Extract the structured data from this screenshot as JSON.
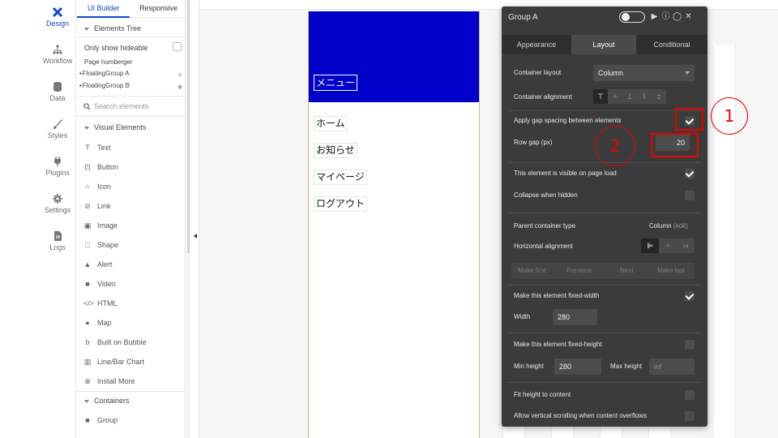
{
  "rail": {
    "items": [
      {
        "label": "Design",
        "icon": "design-icon"
      },
      {
        "label": "Workflow",
        "icon": "workflow-icon"
      },
      {
        "label": "Data",
        "icon": "data-icon"
      },
      {
        "label": "Styles",
        "icon": "brush-icon"
      },
      {
        "label": "Plugins",
        "icon": "plug-icon"
      },
      {
        "label": "Settings",
        "icon": "gear-icon"
      },
      {
        "label": "Logs",
        "icon": "document-icon"
      }
    ]
  },
  "panel": {
    "tabs": [
      "UI Builder",
      "Responsive"
    ],
    "elements_tree": "Elements Tree",
    "only_show_hideable": "Only show hideable",
    "tree_items": [
      "Page humberger",
      "FloatingGroup A",
      "FloatingGroup B"
    ],
    "search_placeholder": "Search elements",
    "visual_elements": "Visual Elements",
    "elements": [
      {
        "label": "Text",
        "icon": "T"
      },
      {
        "label": "Button",
        "icon": "⊡"
      },
      {
        "label": "Icon",
        "icon": "☆"
      },
      {
        "label": "Link",
        "icon": "⊘"
      },
      {
        "label": "Image",
        "icon": "▣"
      },
      {
        "label": "Shape",
        "icon": "□"
      },
      {
        "label": "Alert",
        "icon": "▲"
      },
      {
        "label": "Video",
        "icon": "■"
      },
      {
        "label": "HTML",
        "icon": "</>"
      },
      {
        "label": "Map",
        "icon": "●"
      },
      {
        "label": "Built on Bubble",
        "icon": "b"
      },
      {
        "label": "Line/Bar Chart",
        "icon": "▥"
      },
      {
        "label": "Install More",
        "icon": "⊕"
      }
    ],
    "containers": "Containers",
    "container_items": [
      {
        "label": "Group",
        "icon": "■"
      }
    ]
  },
  "canvas": {
    "menu_button": "メニュー",
    "nav": [
      "ホーム",
      "お知らせ",
      "マイページ",
      "ログアウト"
    ],
    "header_color": "#0000c8"
  },
  "editor": {
    "title": "Group A",
    "tabs": [
      "Appearance",
      "Layout",
      "Conditional"
    ],
    "container_layout_label": "Container layout",
    "container_layout_value": "Column",
    "container_alignment_label": "Container alignment",
    "gap_label": "Apply gap spacing between elements",
    "row_gap_label": "Row gap (px)",
    "row_gap_value": "20",
    "visible_label": "This element is visible on page load",
    "collapse_label": "Collapse when hidden",
    "parent_type_label": "Parent container type",
    "parent_type_value": "Column",
    "parent_type_edit": "(edit)",
    "horizontal_alignment_label": "Horizontal alignment",
    "reorder": [
      "Make first",
      "Previous",
      "Next",
      "Make last"
    ],
    "fixed_width_label": "Make this element fixed-width",
    "width_label": "Width",
    "width_value": "280",
    "fixed_height_label": "Make this element fixed-height",
    "min_height_label": "Min height",
    "min_height_value": "280",
    "max_height_label": "Max height",
    "max_height_placeholder": "inf",
    "fit_height_label": "Fit height to content",
    "scroll_label": "Allow vertical scrolling when content overflows"
  },
  "annotations": {
    "one": "1",
    "two": "2",
    "color": "#e60000"
  }
}
